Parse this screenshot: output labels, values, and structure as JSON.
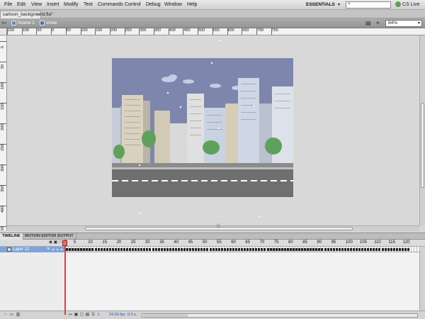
{
  "menu": [
    "File",
    "Edit",
    "View",
    "Insert",
    "Modify",
    "Text",
    "Commands",
    "Control",
    "Debug",
    "Window",
    "Help"
  ],
  "workspace": {
    "label": "ESSENTIALS"
  },
  "search": {
    "placeholder": ""
  },
  "cslive": {
    "label": "CS Live"
  },
  "document_tab": {
    "title": "cartoon_background.fla*"
  },
  "breadcrumb": {
    "scene": "Scene 1",
    "symbol": "snow"
  },
  "zoom": {
    "value": "84%"
  },
  "rulers": {
    "horizontal": [
      "150",
      "100",
      "50",
      "0",
      "50",
      "100",
      "150",
      "200",
      "250",
      "300",
      "350",
      "400",
      "450",
      "500",
      "550",
      "600",
      "650",
      "700",
      "750"
    ],
    "vertical": [
      "0",
      "50",
      "100",
      "150",
      "200",
      "250",
      "300",
      "350",
      "400",
      "450"
    ]
  },
  "panel_tabs": [
    "TIMELINE",
    "MOTION EDITOR",
    "OUTPUT"
  ],
  "timeline": {
    "layer_name": "Layer 12",
    "frame_numbers": [
      "5",
      "10",
      "15",
      "20",
      "25",
      "30",
      "35",
      "40",
      "45",
      "50",
      "55",
      "60",
      "65",
      "70",
      "75",
      "80",
      "85",
      "90",
      "95",
      "100",
      "105",
      "110",
      "115",
      "120"
    ],
    "current_frame": "1",
    "fps": "24.00 fps",
    "time": "0.0 s"
  },
  "colors": {
    "sky": "#7e86ad",
    "road": "#6f6f6f",
    "tree": "#5fa15a",
    "building_light": "#d9d2bf",
    "building_blue": "#c9d2e2",
    "playhead": "#e33c3c",
    "layer_highlight": "#7fa4d8"
  }
}
